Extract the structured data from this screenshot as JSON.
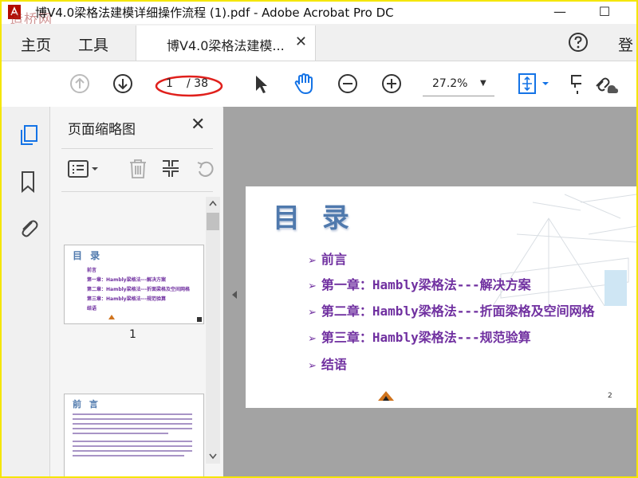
{
  "window": {
    "title": "博V4.0梁格法建模详细操作流程 (1).pdf - Adobe Acrobat Pro DC",
    "watermark": "造桥网",
    "minimize": "—",
    "maximize": "☐"
  },
  "menubar": {
    "home": "主页",
    "tools": "工具",
    "doc_tab": "博V4.0梁格法建模...",
    "doc_tab_close": "✕",
    "login": "登"
  },
  "toolbar": {
    "page_current": "1",
    "page_total": "/ 38",
    "zoom": "27.2%",
    "zoom_arrow": "▼",
    "highlight_color": "#e0201c"
  },
  "thumbnails": {
    "title": "页面缩略图",
    "close": "✕",
    "page1_number": "1",
    "page1": {
      "title": "目 录",
      "items": [
        "前言",
        "第一章：Hambly梁格法---解决方案",
        "第二章：Hambly梁格法---折面梁格及空间网格",
        "第三章：Hambly梁格法---规范验算",
        "结语"
      ]
    },
    "page2": {
      "title": "前 言"
    }
  },
  "page": {
    "title": "目 录",
    "page_number": "2",
    "toc": [
      "前言",
      "第一章：Hambly梁格法---解决方案",
      "第二章：Hambly梁格法---折面梁格及空间网格",
      "第三章：Hambly梁格法---规范验算",
      "结语"
    ],
    "bullet": "➢"
  }
}
